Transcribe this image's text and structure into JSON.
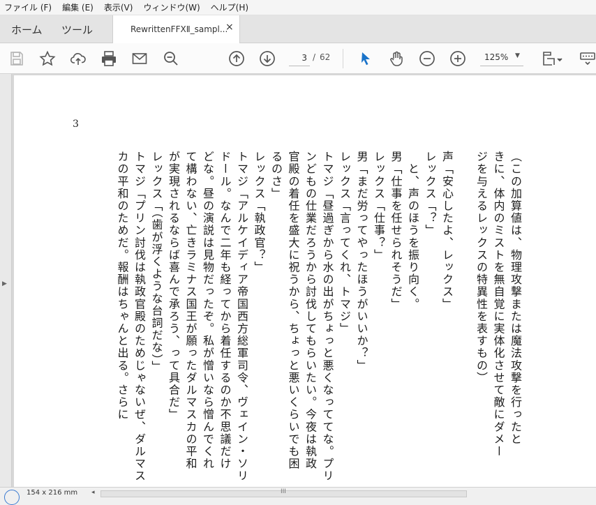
{
  "menu": [
    "ファイル (F)",
    "編集 (E)",
    "表示(V)",
    "ウィンドウ(W)",
    "ヘルプ(H)"
  ],
  "tabs": {
    "home": "ホーム",
    "tools": "ツール",
    "document": "RewrittenFFXⅡ_sampl...",
    "close": "×"
  },
  "toolbar": {
    "icons": [
      "save-icon",
      "star-icon",
      "upload-cloud-icon",
      "print-icon",
      "mail-icon",
      "search-zoom-icon",
      "page-up-icon",
      "page-down-icon",
      "select-cursor-icon",
      "hand-icon",
      "zoom-out-icon",
      "zoom-in-icon",
      "view-mode-icon",
      "more-tools-icon"
    ],
    "current_page": "3",
    "page_separator": "/",
    "total_pages": "62",
    "zoom": "125%",
    "zoom_caret": "▼",
    "accent_color": "#1a73c9"
  },
  "document": {
    "page_number": "3",
    "columns": [
      "（この加算値は、物理攻撃または魔法攻撃を行ったと",
      "きに、体内のミストを無自覚に実体化させて敵にダメー",
      "ジを与えるレックスの特異性を表すもの）",
      "",
      "声「安心したよ、レックス」",
      "レックス「？」",
      "　と、声のほうを振り向く。",
      "男「仕事を任せられそうだ」",
      "レックス「仕事？」",
      "男「まだ労ってやったほうがいいか？」",
      "レックス「言ってくれ、トマジ」",
      "トマジ「昼過ぎから水の出がちょっと悪くなっててな。プリ",
      "ンどもの仕業だろうから討伐してもらいたい。今夜は執政",
      "官殿の着任を盛大に祝うから、ちょっと悪いくらいでも困",
      "るのさ」",
      "レックス「執政官？」",
      "トマジ「アルケイディア帝国西方総軍司令、ヴェイン・ソリ",
      "ドール。なんで二年も経ってから着任するのか不思議だけ",
      "どな。昼の演説は見物だったぞ。私が憎いなら憎んでくれ",
      "て構わない、亡きラミナス国王が願ったダルマスカの平和",
      "が実現されるならば喜んで承ろう、って具合だ」",
      "レックス「（歯が浮くような台詞だな）」",
      "トマジ「プリン討伐は執政官殿のためじゃないぜ、ダルマス",
      "カの平和のためだ。報酬はちゃんと出る。さらに"
    ]
  },
  "status": {
    "page_size": "154 x 216 mm",
    "scroll_left": "◂",
    "scroll_grip": "III",
    "rail_arrow": "▶"
  }
}
